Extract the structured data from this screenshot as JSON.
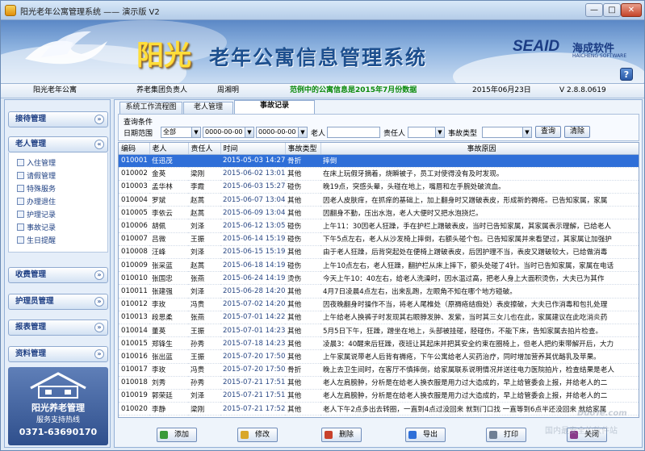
{
  "window": {
    "title": "阳光老年公寓管理系统 —— 演示版 V2",
    "min_glyph": "—",
    "max_glyph": "□",
    "close_glyph": "✕"
  },
  "banner": {
    "brand_big": "阳光",
    "system_name": "老年公寓信息管理系统",
    "vendor_en": "SEAID",
    "vendor_cn": "海成软件",
    "vendor_sub": "HAICHENG SOFTWARE",
    "help_label": "?"
  },
  "infobar": {
    "org": "阳光老年公寓",
    "role": "养老集团负责人",
    "user": "周湘明",
    "notice": "范例中的公寓信息是2015年7月份数据",
    "date": "2015年06月23日",
    "version": "V 2.8.8.0619"
  },
  "sidebar": {
    "groups": [
      {
        "label": "接待管理",
        "chev": "»"
      },
      {
        "label": "老人管理",
        "chev": "«"
      },
      {
        "label": "收费管理",
        "chev": "»"
      },
      {
        "label": "护理员管理",
        "chev": "»"
      },
      {
        "label": "报表管理",
        "chev": "»"
      },
      {
        "label": "资料管理",
        "chev": "»"
      }
    ],
    "elder_items": [
      "入住管理",
      "请假管理",
      "特殊服务",
      "办理退住",
      "护理记录",
      "事故记录",
      "生日提醒"
    ],
    "logo": {
      "name": "阳光养老管理",
      "service": "服务支持热线",
      "phone": "0371-63690170"
    }
  },
  "tabs": [
    "系统工作流程图",
    "老人管理",
    "事故记录"
  ],
  "query": {
    "title": "查询条件",
    "date_range_label": "日期范围",
    "date_range_value": "全部",
    "date_from": "0000-00-00",
    "date_to": "0000-00-00",
    "elder_label": "老人",
    "elder_value": "",
    "staff_label": "责任人",
    "staff_value": "",
    "type_label": "事故类型",
    "type_value": "",
    "search_button": "查询",
    "clear_button": "清除",
    "dropdown_glyph": "▼"
  },
  "grid": {
    "columns": [
      "编码",
      "老人",
      "责任人",
      "时间",
      "事故类型",
      "事故原因"
    ],
    "rows": [
      [
        "010001",
        "任迅茂",
        "",
        "2015-05-03 14:27",
        "骨折",
        "摔倒"
      ],
      [
        "010002",
        "金英",
        "梁刚",
        "2015-06-02 13:01",
        "其他",
        "在床上玩假牙摘着，烧瞬被子，员工对使得没有及时发现。"
      ],
      [
        "010003",
        "孟华林",
        "李霞",
        "2015-06-03 15:27",
        "碰伤",
        "晚19点，突感头晕，头碰在地上，嘴唇和左手腕处破流血。"
      ],
      [
        "010004",
        "罗斌",
        "赵蒿",
        "2015-06-07 13:04",
        "其他",
        "因老人皮肤痒，在抓痒的基础上，加上翻身时又蹭破表皮，形成新的褥疮。已告知家属，家属"
      ],
      [
        "010005",
        "李依云",
        "赵蒿",
        "2015-06-09 13:04",
        "其他",
        "因翻身不勤，压出水泡，老人大便时又把水泡挠烂。"
      ],
      [
        "010006",
        "胡佩",
        "刘泽",
        "2015-06-12 13:05",
        "碰伤",
        "上午11：30因老人狂躁，手在护栏上蹭破表皮，当时已告知家属，其家属表示理解，已给老人"
      ],
      [
        "010007",
        "吕微",
        "王振",
        "2015-06-14 15:19",
        "碰伤",
        "下午5点左右，老人从沙发椅上摔倒，右额头碰个包。已告知家属并来看望过，其家属让加强护"
      ],
      [
        "010008",
        "汪峰",
        "刘泽",
        "2015-06-15 15:19",
        "其他",
        "由于老人狂躁，后背突起处在便椅上蹭破表皮，后因护理不当，表皮又蹭破较大，已给做消毒"
      ],
      [
        "010009",
        "张采蓝",
        "赵蒿",
        "2015-06-18 14:19",
        "碰伤",
        "上午10点左右，老人狂躁，翻护栏从床上摔下，额头处碰了4针。当时已告知家属，家属在电话"
      ],
      [
        "010010",
        "张国忠",
        "张燕",
        "2015-06-24 14:19",
        "烫伤",
        "今天上午10：40左右，给老人洗澡时，因水温过高，把老人身上大面积烫伤，大夫已为其作"
      ],
      [
        "010011",
        "张建强",
        "刘泽",
        "2015-06-28 14:20",
        "其他",
        "4月7日凌晨4点左右，出来乱跑，左眼角不知在哪个地方碰破。"
      ],
      [
        "010012",
        "李玫",
        "冯贵",
        "2015-07-02 14:20",
        "其他",
        "因夜晚翻身时操作不当，将老人尾椎处（原褥疮结痂处）表皮擦破，大夫已作消毒和包扎处理"
      ],
      [
        "010013",
        "段思柔",
        "张燕",
        "2015-07-01 14:22",
        "其他",
        "上午给老人换裤子时发现其右眼脖发肿、发紫，当时其三女儿也在此，家属建议在此吃消炎药"
      ],
      [
        "010014",
        "董英",
        "王振",
        "2015-07-01 14:23",
        "其他",
        "5月5日下午，狂躁，蹭坐在地上，头部被挂碰，胫碰伤，不能下床，告知家属去拍片检查。"
      ],
      [
        "010015",
        "郑锋生",
        "孙秀",
        "2015-07-18 14:23",
        "其他",
        "凌晨3：40醒来后狂躁，夜班让其起床并把其安全约束在圈椅上，但老人把约束带解开后，大力"
      ],
      [
        "010016",
        "张出蓝",
        "王振",
        "2015-07-20 17:50",
        "其他",
        "上午家属说带老人后背有褥疮，下午公寓给老人买药治疗，同时增加营养其优酪乳及苹果。"
      ],
      [
        "010017",
        "李玫",
        "冯贵",
        "2015-07-20 17:50",
        "骨折",
        "晚上去卫生间时，在客厅不慎摔倒，给家属联系说明情况并送往电力医院拍片，检查结果是老人"
      ],
      [
        "010018",
        "刘秀",
        "孙秀",
        "2015-07-21 17:51",
        "其他",
        "老人左肩膀肿，分析是在给老人换衣服是用力过大造成的，早上给管委会上报，并给老人的二"
      ],
      [
        "010019",
        "郭荣廷",
        "刘泽",
        "2015-07-21 17:51",
        "其他",
        "老人左肩膀肿，分析是在给老人换衣服是用力过大造成的，早上给管委会上报，并给老人的二"
      ],
      [
        "010020",
        "李静",
        "梁刚",
        "2015-07-21 17:52",
        "其他",
        "老人下午2点多出去转圈，一直到4点过没回来 就到门口找 一直等到6点半还没回来 就给家属"
      ]
    ]
  },
  "bottom_buttons": [
    "添加",
    "修改",
    "删除",
    "导出",
    "打印",
    "关闭"
  ],
  "colors": {
    "selected_row": "#2f6fd8",
    "notice_green": "#0b8a0b",
    "brand_yellow": "#ffde3a",
    "nav_blue": "#1e3f84"
  },
  "watermark": {
    "line1": "DuoTe.com",
    "line2": "国内最安全的软件站"
  }
}
